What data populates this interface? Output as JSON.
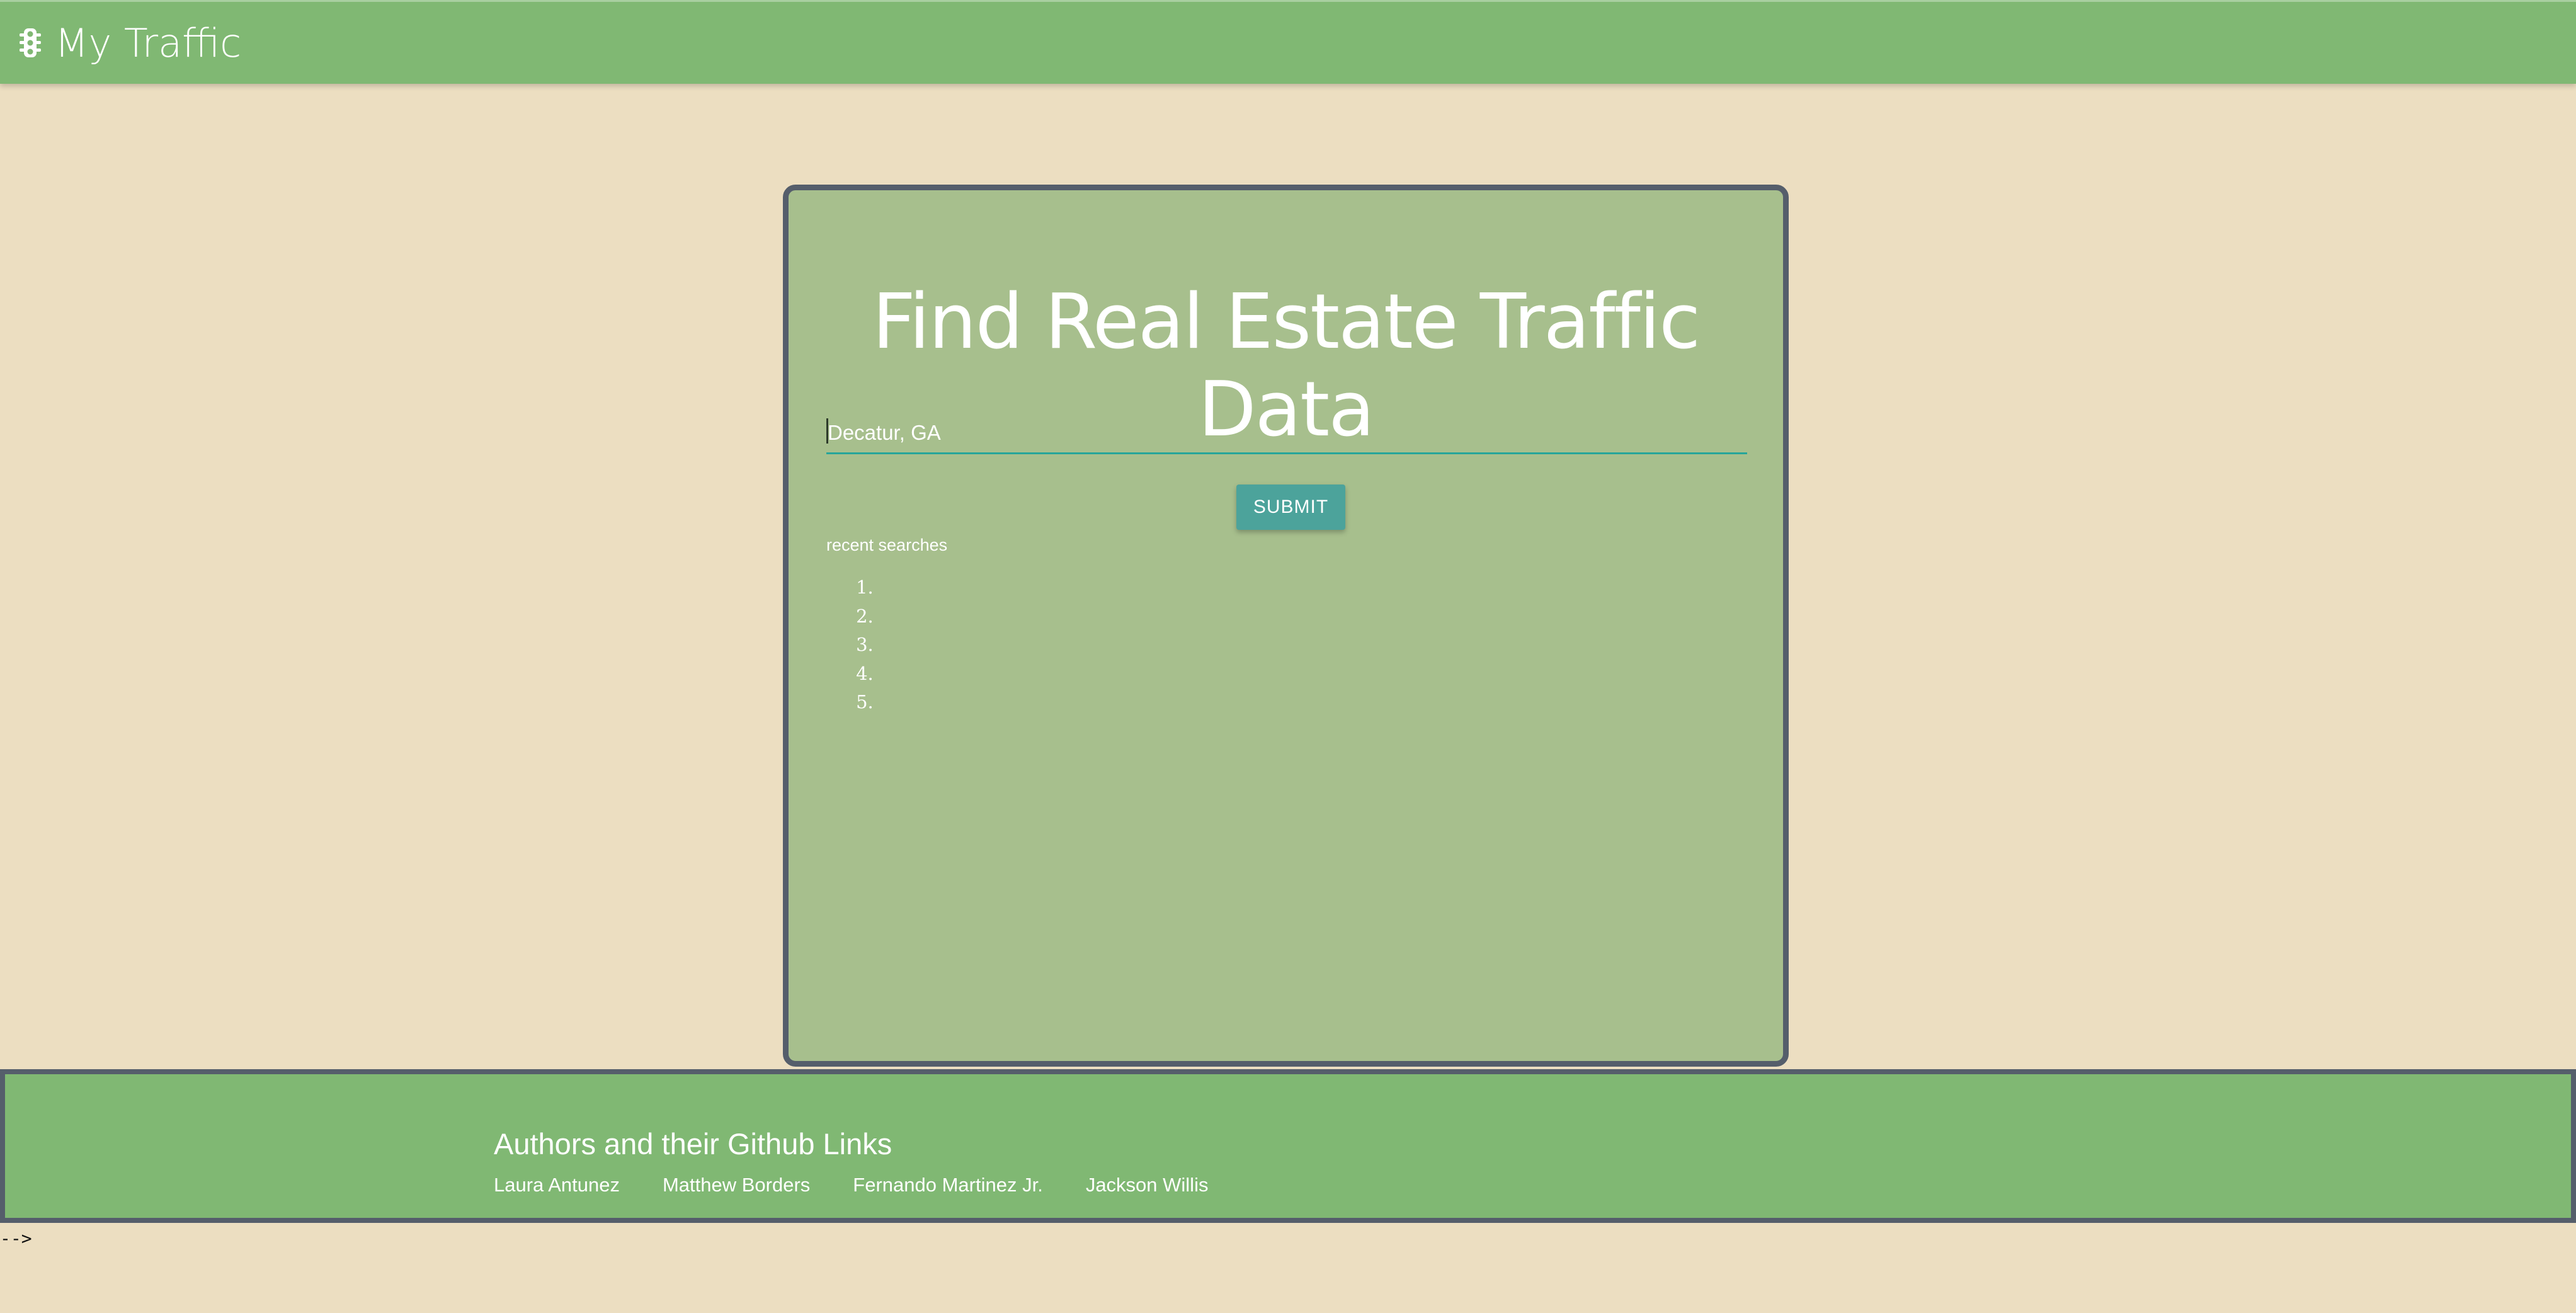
{
  "header": {
    "icon": "traffic-light-icon",
    "title": "My Traffic"
  },
  "main": {
    "title": "Find Real Estate Traffic Data",
    "search": {
      "value": "Decatur, GA"
    },
    "submit_label": "SUBMIT",
    "recent_label": "recent searches",
    "recent_searches": [
      "",
      "",
      "",
      "",
      ""
    ]
  },
  "footer": {
    "title": "Authors and their Github Links",
    "authors": [
      "Laura Antunez",
      "Matthew Borders",
      "Fernando Martinez Jr.",
      "Jackson Willis"
    ]
  },
  "stray_text": "-->",
  "colors": {
    "page_background": "#ecdec1",
    "bar_green": "#80b873",
    "card_green": "#a7bf8d",
    "card_border": "#555e6b",
    "accent_teal": "#4ca39b"
  }
}
